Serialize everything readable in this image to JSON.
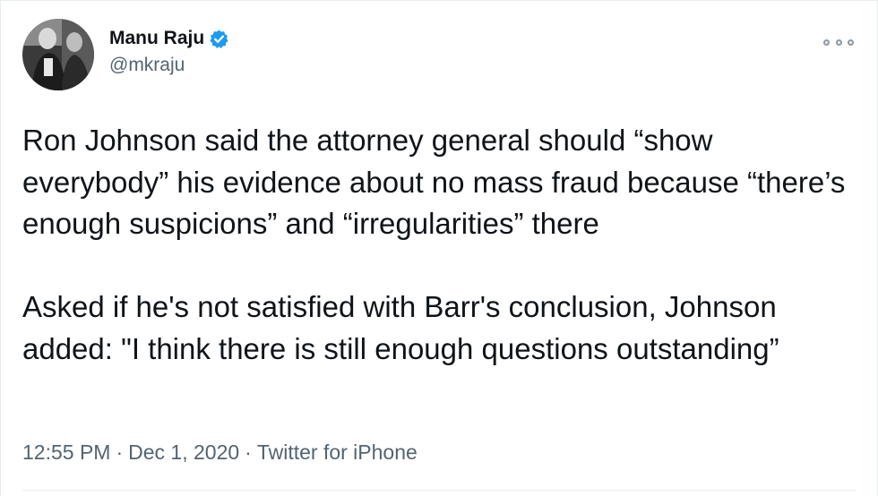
{
  "author": {
    "display_name": "Manu Raju",
    "handle": "@mkraju",
    "verified": true,
    "avatar_icon": "profile-photo-icon"
  },
  "tweet": {
    "paragraphs": [
      "Ron Johnson said the attorney general should “show everybody” his evidence about no mass fraud because “there’s enough suspicions” and “irregularities” there",
      "Asked if he's not satisfied with Barr's conclusion, Johnson added: \"I think there is still enough questions outstanding”"
    ],
    "time": "12:55 PM",
    "date": "Dec 1, 2020",
    "source": "Twitter for iPhone",
    "separator": "·"
  },
  "icons": {
    "more": "more-options-icon",
    "verified": "verified-badge-icon"
  },
  "colors": {
    "verified_blue": "#1d9bf0",
    "secondary_text": "#536471",
    "primary_text": "#0f1419"
  }
}
